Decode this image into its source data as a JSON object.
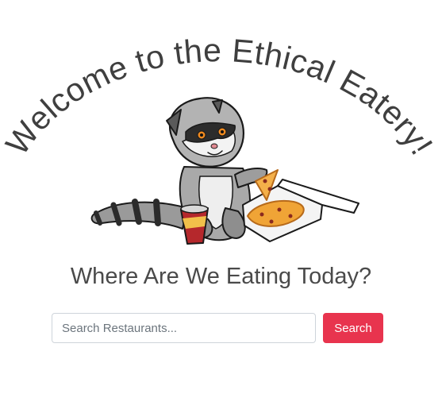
{
  "hero": {
    "title": "Welcome to the Ethical Eatery!",
    "mascot_icon": "raccoon-eating-pizza-illustration"
  },
  "main": {
    "heading": "Where Are We Eating Today?"
  },
  "search": {
    "placeholder": "Search Restaurants...",
    "value": "",
    "button_label": "Search"
  },
  "colors": {
    "accent": "#e8344e",
    "text": "#4a4a4a",
    "title": "#3f3f3f"
  }
}
